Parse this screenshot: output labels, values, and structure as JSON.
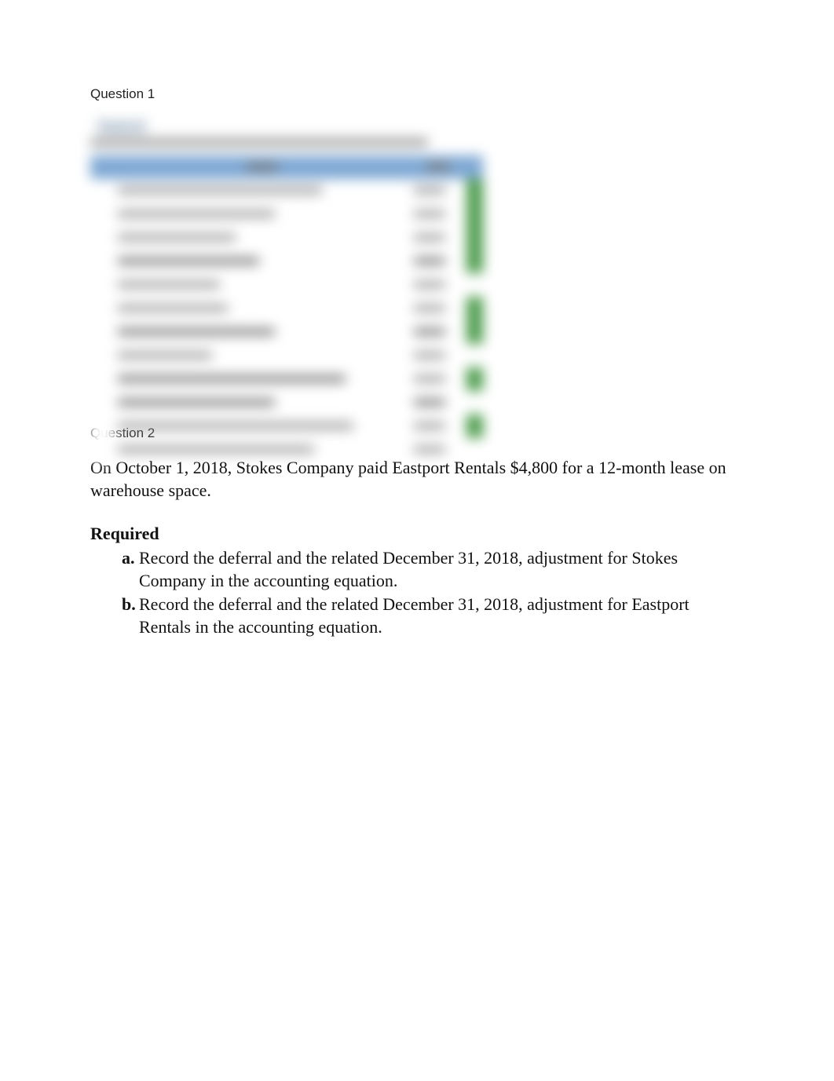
{
  "q1": {
    "label": "Question 1",
    "blurred_title": "Required"
  },
  "q2": {
    "label": "Question 2",
    "body": "On October 1, 2018, Stokes Company paid Eastport Rentals $4,800 for a 12-month lease on warehouse space.",
    "required_heading": "Required",
    "items": [
      {
        "marker": "a.",
        "text": "Record the deferral and the related December 31, 2018, adjustment for Stokes Company in the accounting equation."
      },
      {
        "marker": "b.",
        "text": "Record the deferral and the related December 31, 2018, adjustment for Eastport Rentals in the accounting equation."
      }
    ]
  }
}
